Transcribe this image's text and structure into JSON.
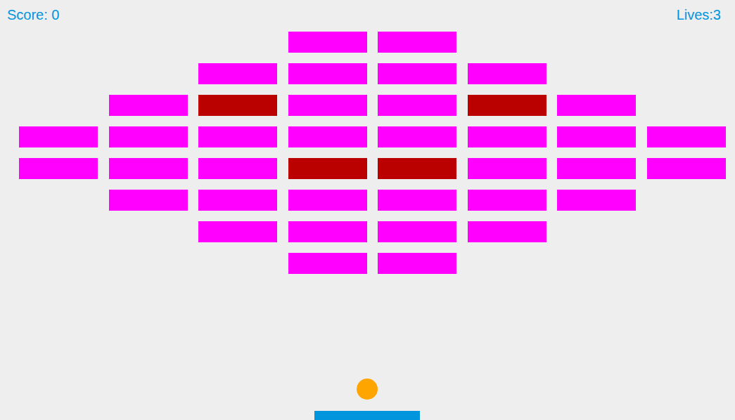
{
  "hud": {
    "score": "Score: 0",
    "lives": "Lives:3"
  },
  "bricks": {
    "rows": [
      [
        {
          "visible": false
        },
        {
          "visible": false
        },
        {
          "visible": false
        },
        {
          "visible": true,
          "color": "#ff00ff"
        },
        {
          "visible": true,
          "color": "#ff00ff"
        },
        {
          "visible": false
        },
        {
          "visible": false
        },
        {
          "visible": false
        }
      ],
      [
        {
          "visible": false
        },
        {
          "visible": false
        },
        {
          "visible": true,
          "color": "#ff00ff"
        },
        {
          "visible": true,
          "color": "#ff00ff"
        },
        {
          "visible": true,
          "color": "#ff00ff"
        },
        {
          "visible": true,
          "color": "#ff00ff"
        },
        {
          "visible": false
        },
        {
          "visible": false
        }
      ],
      [
        {
          "visible": false
        },
        {
          "visible": true,
          "color": "#ff00ff"
        },
        {
          "visible": true,
          "color": "#bb0000"
        },
        {
          "visible": true,
          "color": "#ff00ff"
        },
        {
          "visible": true,
          "color": "#ff00ff"
        },
        {
          "visible": true,
          "color": "#bb0000"
        },
        {
          "visible": true,
          "color": "#ff00ff"
        },
        {
          "visible": false
        }
      ],
      [
        {
          "visible": true,
          "color": "#ff00ff"
        },
        {
          "visible": true,
          "color": "#ff00ff"
        },
        {
          "visible": true,
          "color": "#ff00ff"
        },
        {
          "visible": true,
          "color": "#ff00ff"
        },
        {
          "visible": true,
          "color": "#ff00ff"
        },
        {
          "visible": true,
          "color": "#ff00ff"
        },
        {
          "visible": true,
          "color": "#ff00ff"
        },
        {
          "visible": true,
          "color": "#ff00ff"
        }
      ],
      [
        {
          "visible": true,
          "color": "#ff00ff"
        },
        {
          "visible": true,
          "color": "#ff00ff"
        },
        {
          "visible": true,
          "color": "#ff00ff"
        },
        {
          "visible": true,
          "color": "#bb0000"
        },
        {
          "visible": true,
          "color": "#bb0000"
        },
        {
          "visible": true,
          "color": "#ff00ff"
        },
        {
          "visible": true,
          "color": "#ff00ff"
        },
        {
          "visible": true,
          "color": "#ff00ff"
        }
      ],
      [
        {
          "visible": false
        },
        {
          "visible": true,
          "color": "#ff00ff"
        },
        {
          "visible": true,
          "color": "#ff00ff"
        },
        {
          "visible": true,
          "color": "#ff00ff"
        },
        {
          "visible": true,
          "color": "#ff00ff"
        },
        {
          "visible": true,
          "color": "#ff00ff"
        },
        {
          "visible": true,
          "color": "#ff00ff"
        },
        {
          "visible": false
        }
      ],
      [
        {
          "visible": false
        },
        {
          "visible": false
        },
        {
          "visible": true,
          "color": "#ff00ff"
        },
        {
          "visible": true,
          "color": "#ff00ff"
        },
        {
          "visible": true,
          "color": "#ff00ff"
        },
        {
          "visible": true,
          "color": "#ff00ff"
        },
        {
          "visible": false
        },
        {
          "visible": false
        }
      ],
      [
        {
          "visible": false
        },
        {
          "visible": false
        },
        {
          "visible": false
        },
        {
          "visible": true,
          "color": "#ff00ff"
        },
        {
          "visible": true,
          "color": "#ff00ff"
        },
        {
          "visible": false
        },
        {
          "visible": false
        },
        {
          "visible": false
        }
      ]
    ]
  }
}
